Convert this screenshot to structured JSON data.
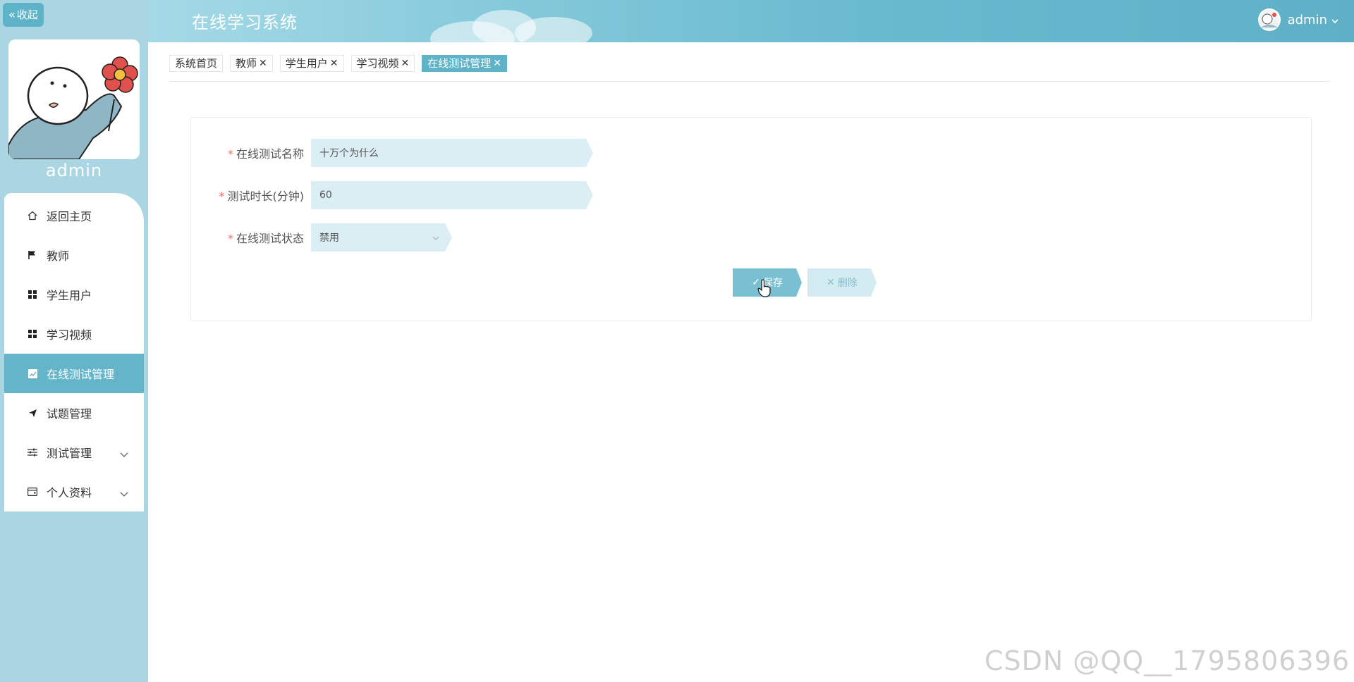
{
  "sidebar": {
    "collapse_label": "收起",
    "username": "admin",
    "menu": [
      {
        "label": "返回主页",
        "icon": "home-icon"
      },
      {
        "label": "教师",
        "icon": "flag-icon"
      },
      {
        "label": "学生用户",
        "icon": "grid-icon"
      },
      {
        "label": "学习视频",
        "icon": "grid-icon"
      },
      {
        "label": "在线测试管理",
        "icon": "chart-icon",
        "active": true
      },
      {
        "label": "试题管理",
        "icon": "send-icon"
      },
      {
        "label": "测试管理",
        "icon": "sliders-icon",
        "expandable": true
      },
      {
        "label": "个人资料",
        "icon": "wallet-icon",
        "expandable": true
      }
    ]
  },
  "header": {
    "title": "在线学习系统",
    "user": "admin"
  },
  "tabs": [
    {
      "label": "系统首页",
      "closable": false
    },
    {
      "label": "教师",
      "closable": true
    },
    {
      "label": "学生用户",
      "closable": true
    },
    {
      "label": "学习视频",
      "closable": true
    },
    {
      "label": "在线测试管理",
      "closable": true,
      "active": true
    }
  ],
  "form": {
    "name_label": "在线测试名称",
    "name_value": "十万个为什么",
    "duration_label": "测试时长(分钟)",
    "duration_value": "60",
    "status_label": "在线测试状态",
    "status_value": "禁用",
    "save_label": "保存",
    "delete_label": "删除"
  },
  "watermark": "CSDN @QQ__1795806396",
  "colors": {
    "accent": "#5fb3c8",
    "sidebar_bg": "#a9d6e2",
    "field_bg": "#dbeef3",
    "required": "#f56c6c"
  }
}
